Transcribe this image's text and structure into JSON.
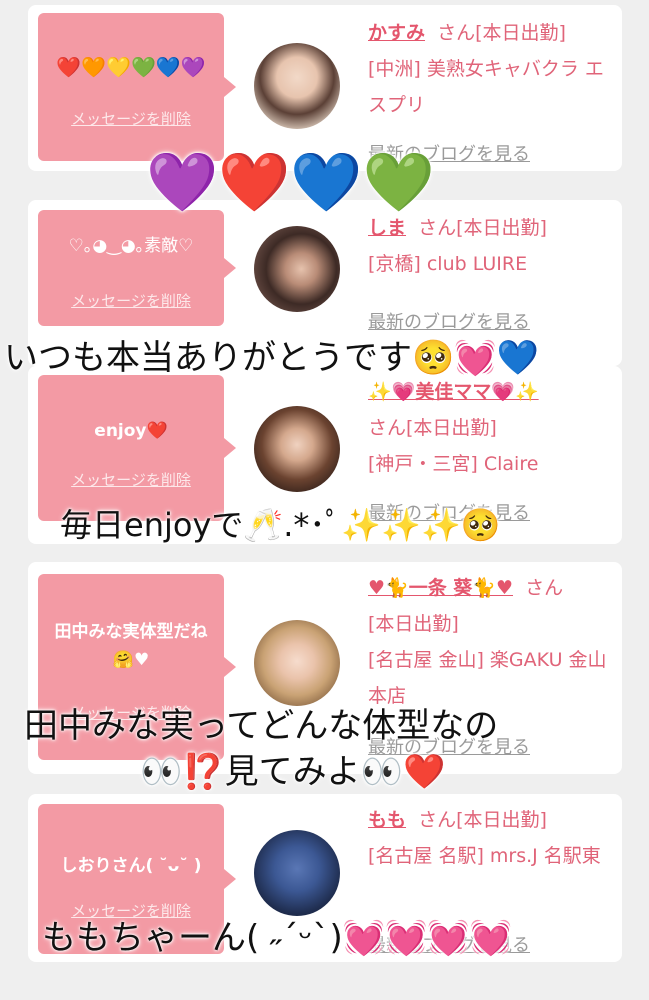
{
  "colors": {
    "bubble": "#f39aa4",
    "name": "#e4566d",
    "text": "#e06479",
    "link": "#9a9a9a"
  },
  "delete_label": "メッセージを削除",
  "blog_label": "最新のブログを見る",
  "san_label": "さん",
  "cards": [
    {
      "message": "❤️🧡💛💚💙💜",
      "name": "かすみ",
      "status": "[本日出勤]",
      "store": "[中洲] 美熟女キャバクラ エスプリ"
    },
    {
      "message": "♡｡◕‿◕｡素敵♡",
      "name": "しま",
      "status": "[本日出勤]",
      "store": "[京橋] club LUIRE"
    },
    {
      "message": "enjoy❤️",
      "name": "✨💗美佳ママ💗✨",
      "status": "さん[本日出勤]",
      "store": "[神戸・三宮] Claire"
    },
    {
      "message": "田中みな実体型だね🤗♥",
      "name": "♥🐈一条 葵🐈♥",
      "status": "[本日出勤]",
      "store": "[名古屋 金山] 楽GAKU 金山本店"
    },
    {
      "message": "しおりさん( ˘ᴗ˘ )",
      "name": "もも",
      "status": "[本日出勤]",
      "store": "[名古屋 名駅] mrs.J 名駅東"
    }
  ],
  "overlay": {
    "hearts": "💜❤️💙💚",
    "line1": "いつも本当ありがとうです🥺💓💙",
    "line2": "毎日enjoyで🥂.*･ﾟ✨✨✨🥺",
    "line3a": "田中みな実ってどんな体型なの",
    "line3b": "👀⁉️見てみよ👀❤️",
    "line4": "ももちゃーん( ˶ˊᵕˋ)💓💓💓💓"
  }
}
